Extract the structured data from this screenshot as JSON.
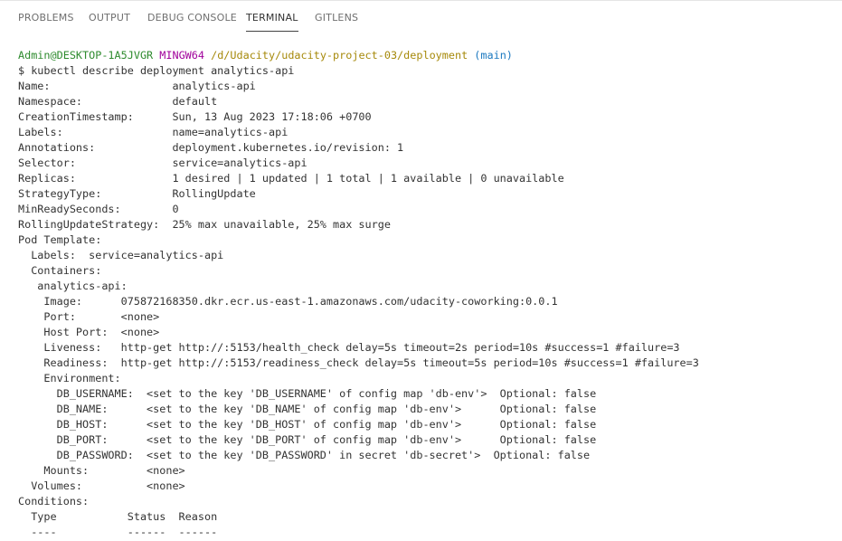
{
  "panel": {
    "tabs": [
      {
        "label": "PROBLEMS",
        "active": false
      },
      {
        "label": "OUTPUT",
        "active": false
      },
      {
        "label": "DEBUG CONSOLE",
        "active": false
      },
      {
        "label": "TERMINAL",
        "active": true
      },
      {
        "label": "GITLENS",
        "active": false
      }
    ]
  },
  "terminal": {
    "prompt": {
      "user_host": "Admin@DESKTOP-1A5JVGR",
      "shell": "MINGW64",
      "path": "/d/Udacity/udacity-project-03/deployment",
      "branch": "(main)"
    },
    "command": "$ kubectl describe deployment analytics-api",
    "lines": [
      "Name:                   analytics-api",
      "Namespace:              default",
      "CreationTimestamp:      Sun, 13 Aug 2023 17:18:06 +0700",
      "Labels:                 name=analytics-api",
      "Annotations:            deployment.kubernetes.io/revision: 1",
      "Selector:               service=analytics-api",
      "Replicas:               1 desired | 1 updated | 1 total | 1 available | 0 unavailable",
      "StrategyType:           RollingUpdate",
      "MinReadySeconds:        0",
      "RollingUpdateStrategy:  25% max unavailable, 25% max surge",
      "Pod Template:",
      "  Labels:  service=analytics-api",
      "  Containers:",
      "   analytics-api:",
      "    Image:      075872168350.dkr.ecr.us-east-1.amazonaws.com/udacity-coworking:0.0.1",
      "    Port:       <none>",
      "    Host Port:  <none>",
      "    Liveness:   http-get http://:5153/health_check delay=5s timeout=2s period=10s #success=1 #failure=3",
      "    Readiness:  http-get http://:5153/readiness_check delay=5s timeout=5s period=10s #success=1 #failure=3",
      "    Environment:",
      "      DB_USERNAME:  <set to the key 'DB_USERNAME' of config map 'db-env'>  Optional: false",
      "      DB_NAME:      <set to the key 'DB_NAME' of config map 'db-env'>      Optional: false",
      "      DB_HOST:      <set to the key 'DB_HOST' of config map 'db-env'>      Optional: false",
      "      DB_PORT:      <set to the key 'DB_PORT' of config map 'db-env'>      Optional: false",
      "      DB_PASSWORD:  <set to the key 'DB_PASSWORD' in secret 'db-secret'>  Optional: false",
      "    Mounts:         <none>",
      "  Volumes:          <none>",
      "Conditions:",
      "  Type           Status  Reason",
      "  ----           ------  ------"
    ]
  }
}
